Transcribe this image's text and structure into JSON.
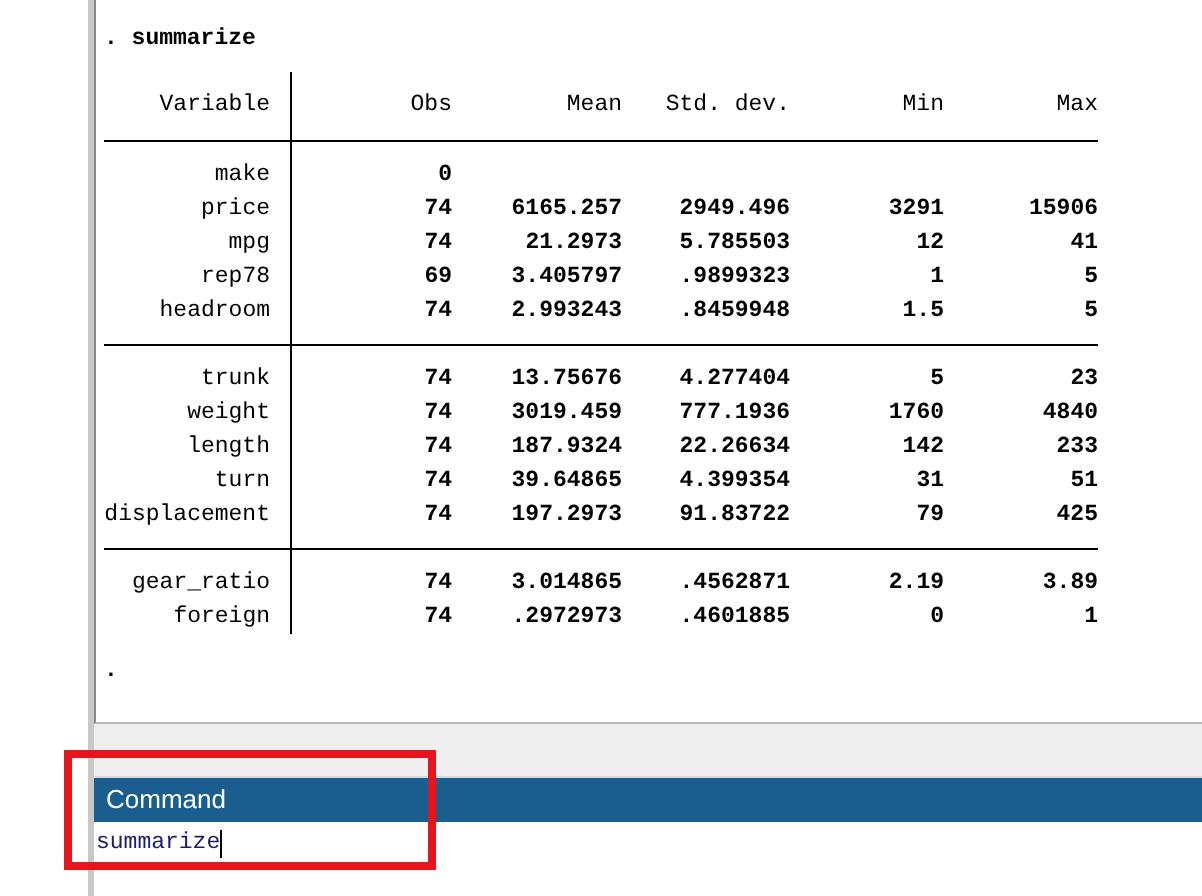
{
  "results": {
    "command_echo": ". summarize",
    "table": {
      "columns": [
        "Variable",
        "Obs",
        "Mean",
        "Std. dev.",
        "Min",
        "Max"
      ],
      "groups": [
        {
          "rows": [
            {
              "variable": "make",
              "obs": "0"
            },
            {
              "variable": "price",
              "obs": "74",
              "mean": "6165.257",
              "std_dev": "2949.496",
              "min": "3291",
              "max": "15906"
            },
            {
              "variable": "mpg",
              "obs": "74",
              "mean": "21.2973",
              "std_dev": "5.785503",
              "min": "12",
              "max": "41"
            },
            {
              "variable": "rep78",
              "obs": "69",
              "mean": "3.405797",
              "std_dev": ".9899323",
              "min": "1",
              "max": "5"
            },
            {
              "variable": "headroom",
              "obs": "74",
              "mean": "2.993243",
              "std_dev": ".8459948",
              "min": "1.5",
              "max": "5"
            }
          ]
        },
        {
          "rows": [
            {
              "variable": "trunk",
              "obs": "74",
              "mean": "13.75676",
              "std_dev": "4.277404",
              "min": "5",
              "max": "23"
            },
            {
              "variable": "weight",
              "obs": "74",
              "mean": "3019.459",
              "std_dev": "777.1936",
              "min": "1760",
              "max": "4840"
            },
            {
              "variable": "length",
              "obs": "74",
              "mean": "187.9324",
              "std_dev": "22.26634",
              "min": "142",
              "max": "233"
            },
            {
              "variable": "turn",
              "obs": "74",
              "mean": "39.64865",
              "std_dev": "4.399354",
              "min": "31",
              "max": "51"
            },
            {
              "variable": "displacement",
              "obs": "74",
              "mean": "197.2973",
              "std_dev": "91.83722",
              "min": "79",
              "max": "425"
            }
          ]
        },
        {
          "rows": [
            {
              "variable": "gear_ratio",
              "obs": "74",
              "mean": "3.014865",
              "std_dev": ".4562871",
              "min": "2.19",
              "max": "3.89"
            },
            {
              "variable": "foreign",
              "obs": "74",
              "mean": ".2972973",
              "std_dev": ".4601885",
              "min": "0",
              "max": "1"
            }
          ]
        }
      ]
    },
    "prompt": "."
  },
  "command_panel": {
    "title": "Command",
    "value": "summarize"
  },
  "annotation": {
    "kind": "highlight_frame"
  }
}
